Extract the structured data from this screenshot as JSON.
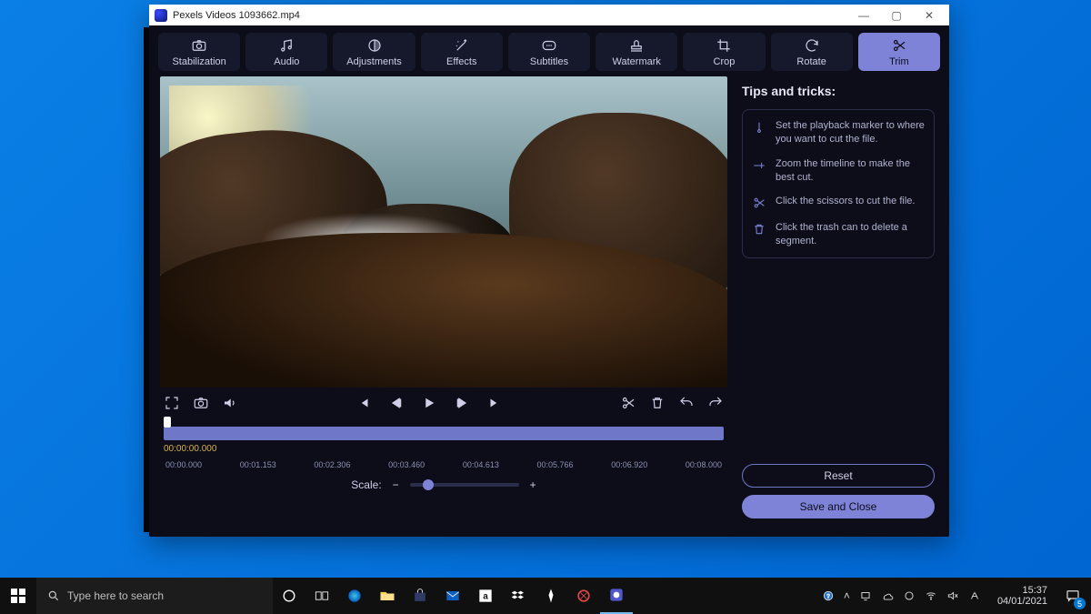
{
  "window": {
    "title": "Pexels Videos 1093662.mp4"
  },
  "tabs": [
    {
      "label": "Stabilization"
    },
    {
      "label": "Audio"
    },
    {
      "label": "Adjustments"
    },
    {
      "label": "Effects"
    },
    {
      "label": "Subtitles"
    },
    {
      "label": "Watermark"
    },
    {
      "label": "Crop"
    },
    {
      "label": "Rotate"
    },
    {
      "label": "Trim",
      "active": true
    }
  ],
  "timeline": {
    "current": "00:00:00.000",
    "ticks": [
      "00:00.000",
      "00:01.153",
      "00:02.306",
      "00:03.460",
      "00:04.613",
      "00:05.766",
      "00:06.920",
      "00:08.000"
    ],
    "scale_label": "Scale:"
  },
  "tips": {
    "heading": "Tips and tricks:",
    "items": [
      "Set the playback marker to where you want to cut the file.",
      "Zoom the timeline to make the best cut.",
      "Click the scissors to cut the file.",
      "Click the trash can to delete a segment."
    ]
  },
  "buttons": {
    "reset": "Reset",
    "save": "Save and Close"
  },
  "taskbar": {
    "search_placeholder": "Type here to search",
    "time": "15:37",
    "date": "04/01/2021",
    "notif_count": "5"
  }
}
